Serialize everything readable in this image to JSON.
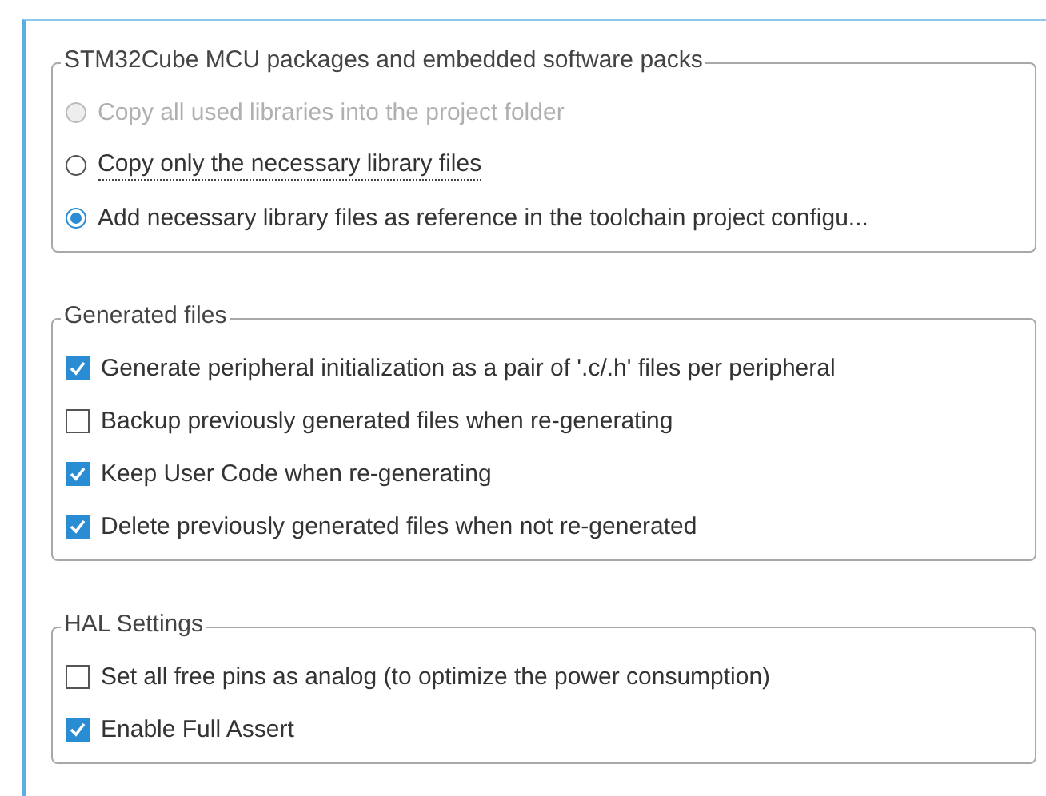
{
  "groups": [
    {
      "title": "STM32Cube MCU packages and embedded software packs",
      "kind": "radio",
      "items": [
        {
          "label": "Copy all used libraries into the project folder",
          "selected": false,
          "disabled": true,
          "focused": false
        },
        {
          "label": "Copy only the necessary library files",
          "selected": false,
          "disabled": false,
          "focused": true
        },
        {
          "label": "Add necessary library files as reference in the toolchain project configu...",
          "selected": true,
          "disabled": false,
          "focused": false
        }
      ]
    },
    {
      "title": "Generated files",
      "kind": "checkbox",
      "items": [
        {
          "label": "Generate peripheral initialization as a pair of '.c/.h' files per peripheral",
          "checked": true
        },
        {
          "label": "Backup previously generated files when re-generating",
          "checked": false
        },
        {
          "label": "Keep User Code when re-generating",
          "checked": true
        },
        {
          "label": "Delete previously generated files when not re-generated",
          "checked": true
        }
      ]
    },
    {
      "title": "HAL Settings",
      "kind": "checkbox",
      "items": [
        {
          "label": "Set all free pins as analog (to optimize the power consumption)",
          "checked": false
        },
        {
          "label": "Enable Full Assert",
          "checked": true
        }
      ]
    }
  ]
}
